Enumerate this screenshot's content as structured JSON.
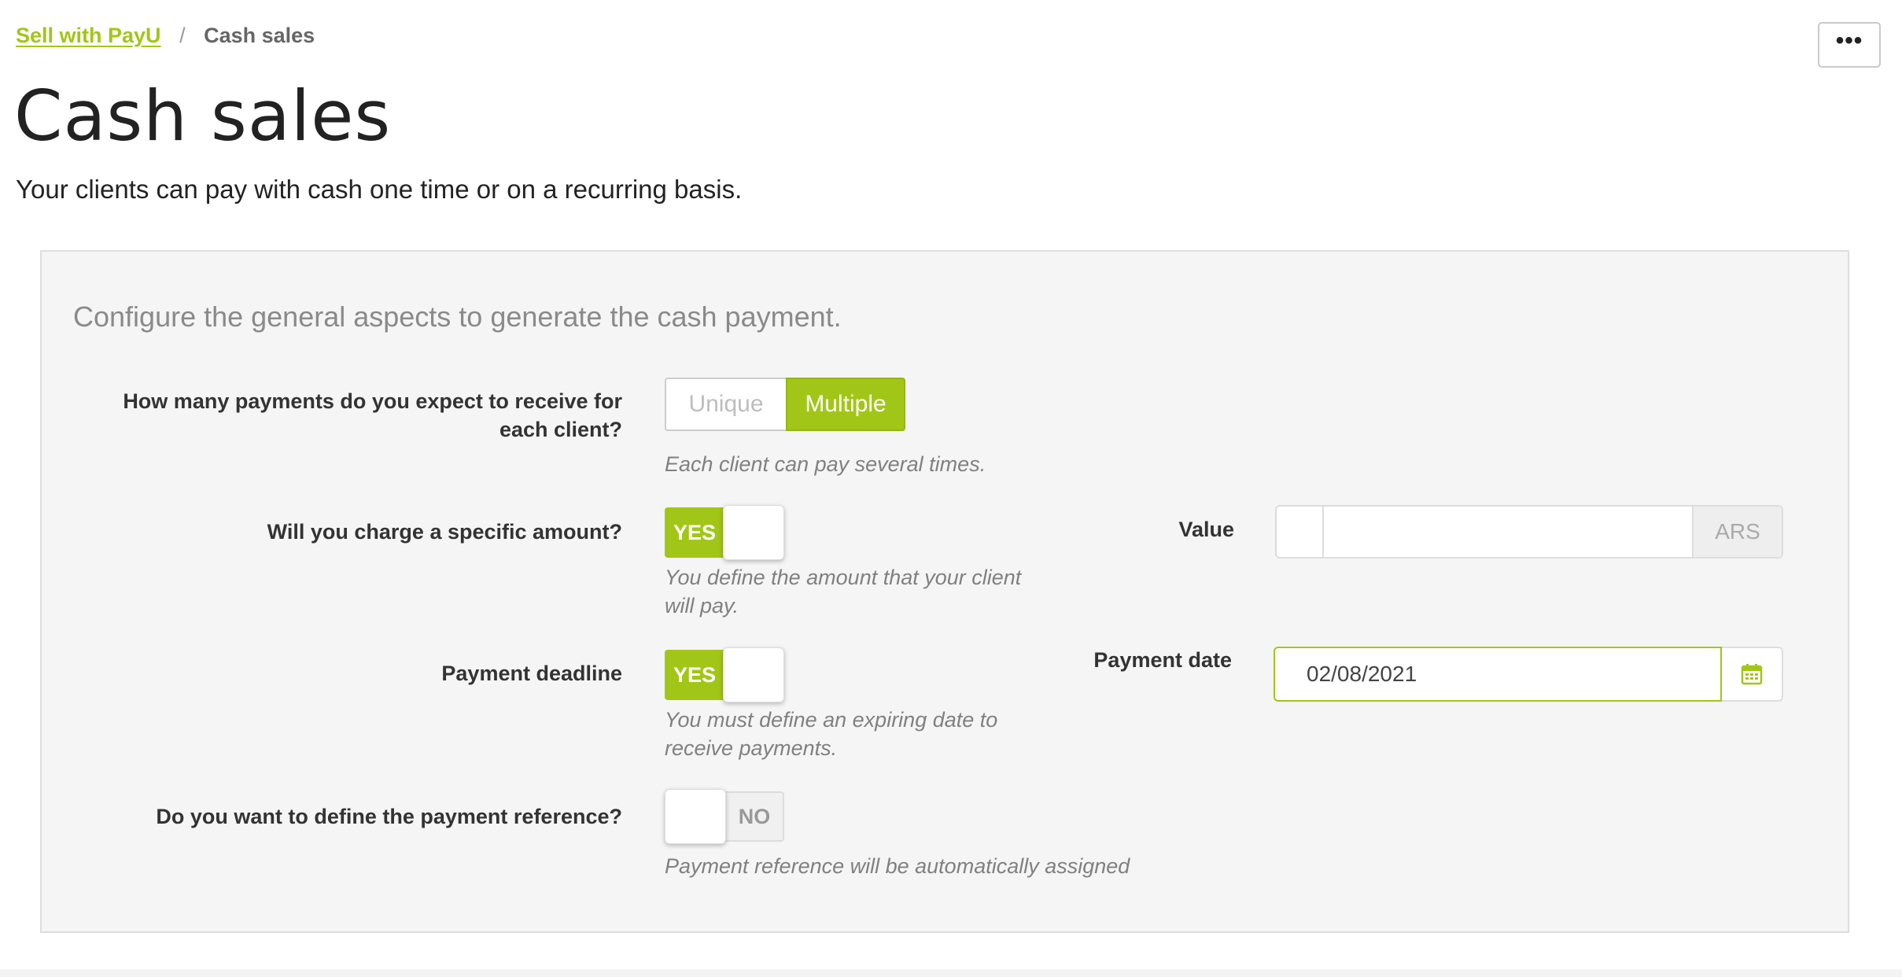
{
  "breadcrumb": {
    "parent": "Sell with PayU",
    "separator": "/",
    "current": "Cash sales"
  },
  "header": {
    "more_label": "•••",
    "title": "Cash sales",
    "subtitle": "Your clients can pay with cash one time or on a recurring basis."
  },
  "form": {
    "heading": "Configure the general aspects to generate the cash payment.",
    "payments_question": {
      "label_line1": "How many payments do you expect to receive for",
      "label_line2": "each client?",
      "options": [
        "Unique",
        "Multiple"
      ],
      "selected": "Multiple",
      "hint": "Each client can pay several times."
    },
    "specific_amount": {
      "label": "Will you charge a specific amount?",
      "toggle": "YES",
      "hint_line1": "You define the amount that your client",
      "hint_line2": "will pay.",
      "value_label": "Value",
      "value": "",
      "currency": "ARS"
    },
    "payment_deadline": {
      "label": "Payment deadline",
      "toggle": "YES",
      "hint_line1": "You must define an expiring date to",
      "hint_line2": "receive payments.",
      "date_label": "Payment date",
      "date_value": "02/08/2021",
      "date_icon": "calendar-icon"
    },
    "payment_reference": {
      "label": "Do you want to define the payment reference?",
      "toggle": "NO",
      "hint": "Payment reference will be automatically assigned"
    }
  },
  "colors": {
    "accent": "#a2c617",
    "panel_bg": "#f5f5f5",
    "hint_text": "#808080"
  }
}
